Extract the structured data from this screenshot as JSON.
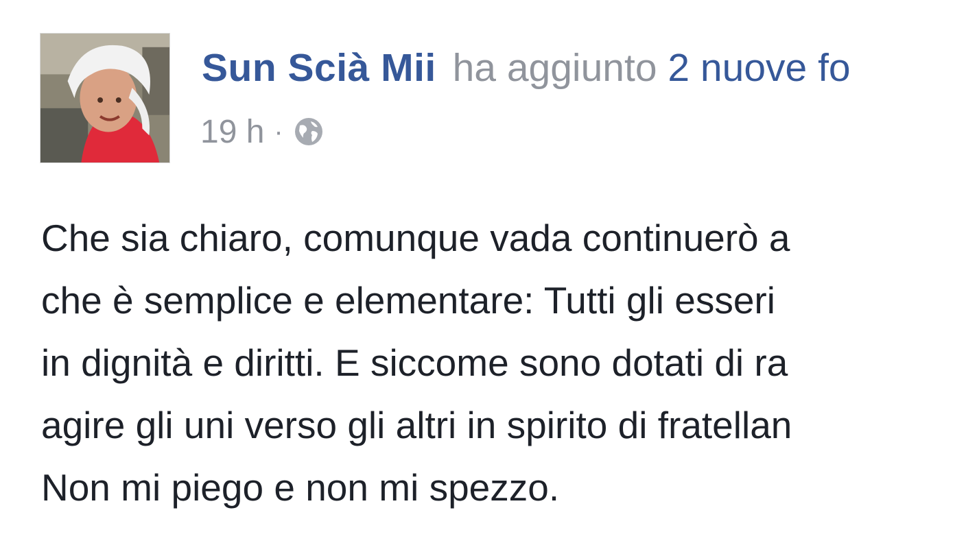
{
  "post": {
    "author_name": "Sun Scià Mii",
    "action_text": "ha aggiunto",
    "action_link": "2 nuove fo",
    "timestamp": "19 h",
    "separator": "·",
    "privacy_icon": "globe-icon",
    "body_lines": [
      "Che sia chiaro, comunque vada continuerò a",
      "che è semplice e elementare: Tutti gli esseri",
      "in dignità e diritti. E siccome sono dotati di ra",
      "agire gli uni verso gli altri in spirito di fratellan",
      "Non mi piego e non mi spezzo."
    ]
  },
  "colors": {
    "author_link": "#365899",
    "secondary_text": "#90949c",
    "body_text": "#1d2129",
    "background": "#ffffff"
  }
}
